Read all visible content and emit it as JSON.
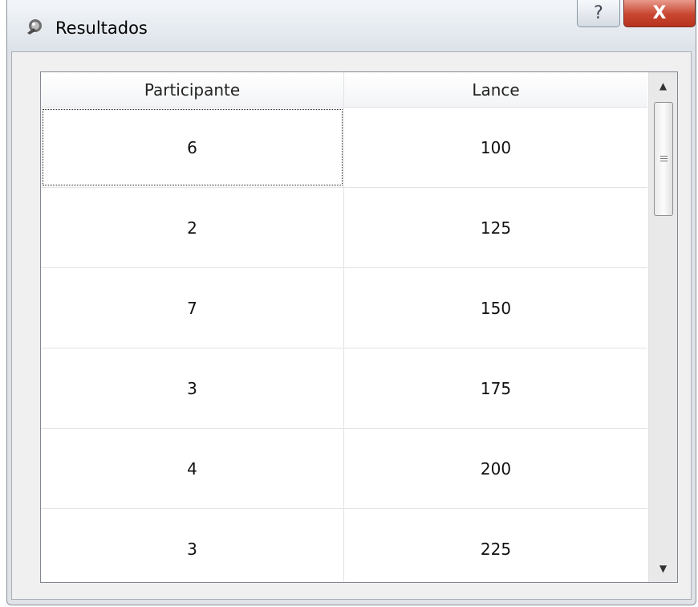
{
  "window": {
    "title": "Resultados",
    "help_glyph": "?",
    "close_glyph": "X"
  },
  "table": {
    "columns": [
      "Participante",
      "Lance"
    ],
    "rows": [
      {
        "participante": "6",
        "lance": "100"
      },
      {
        "participante": "2",
        "lance": "125"
      },
      {
        "participante": "7",
        "lance": "150"
      },
      {
        "participante": "3",
        "lance": "175"
      },
      {
        "participante": "4",
        "lance": "200"
      },
      {
        "participante": "3",
        "lance": "225"
      }
    ]
  },
  "scrollbar": {
    "up_glyph": "▲",
    "down_glyph": "▼"
  },
  "colors": {
    "close_button": "#c8452f",
    "window_frame": "#dfe3e8",
    "table_background": "#ffffff"
  },
  "icons": {
    "title": "app-window-icon",
    "help": "help-icon",
    "close": "close-icon",
    "scroll_up": "arrow-up-icon",
    "scroll_down": "arrow-down-icon"
  }
}
